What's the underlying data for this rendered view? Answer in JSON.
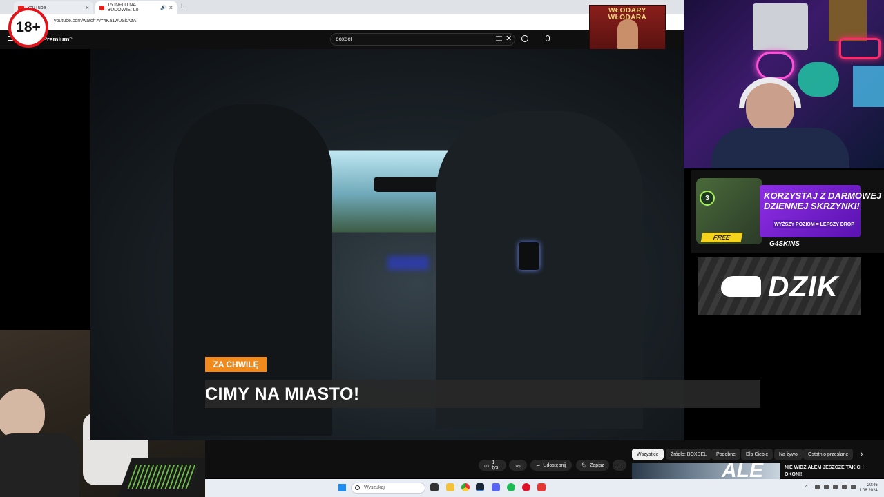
{
  "badge": "18+",
  "tabs": [
    {
      "label": "YouTube"
    },
    {
      "label": "15 INFLU NA BUDOWIE: Lo"
    }
  ],
  "address": {
    "url": "youtube.com/watch?v=4Ka1wUSkAzA"
  },
  "youtube": {
    "logo": "Premium",
    "logo_sup": "PL",
    "search_value": "boxdel"
  },
  "poster_text": "WŁODARY WŁODARA",
  "video": {
    "tag": "ZA CHWILĘ",
    "headline": "CIMY NA MIASTO!"
  },
  "ads": {
    "g4": {
      "level": "3",
      "line1": "KORZYSTAJ Z DARMOWEJ",
      "line2": "DZIENNEJ SKRZYNKI!",
      "sub": "WYŻSZY POZIOM = LEPSZY DROP",
      "free": "FREE",
      "brand": "G4SKINS"
    },
    "dzik": {
      "brand": "DZIK"
    }
  },
  "actions": {
    "likes": "1 tys.",
    "share": "Udostępnij",
    "save": "Zapisz"
  },
  "chips": [
    "Wszystkie",
    "Źródło: BOXDEL",
    "Podobne",
    "Dla Ciebie",
    "Na żywo",
    "Ostatnio przesłane"
  ],
  "recommended": {
    "title1": "NIE WIDZIAŁEM JESZCZE TAKICH",
    "title2": "OKONI!",
    "thumb_text": "ALE"
  },
  "taskbar": {
    "search": "Wyszukaj",
    "time": "20:46",
    "date": "1.08.2024"
  },
  "colors": {
    "accent_orange": "#f08a1c",
    "yt_red": "#e62117",
    "ad_purple": "#8a2be2",
    "chip_active": "#f1f1f1"
  }
}
